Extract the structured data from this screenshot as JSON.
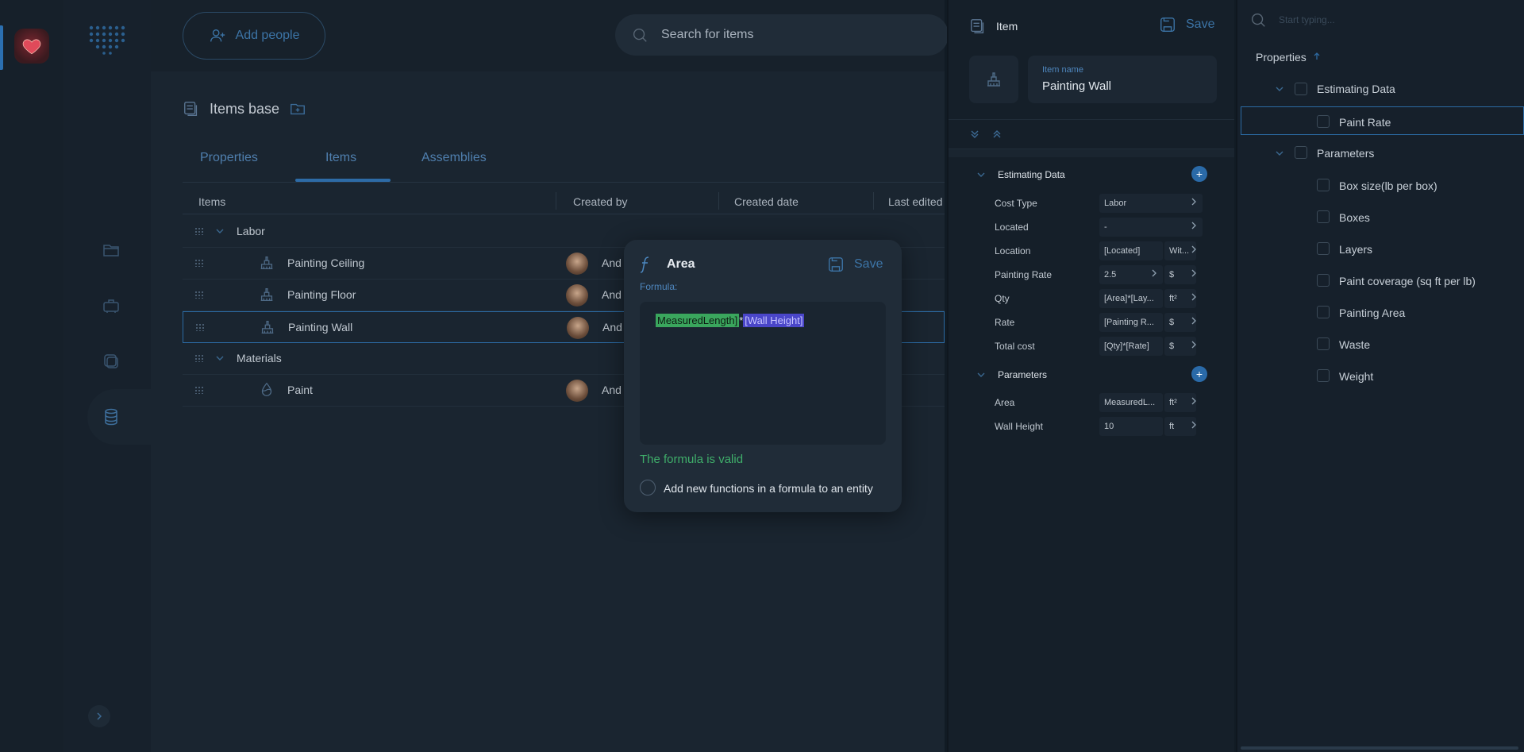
{
  "header": {
    "add_people": "Add people",
    "search_placeholder": "Search for items"
  },
  "page": {
    "title": "Items base"
  },
  "tabs": [
    {
      "label": "Properties"
    },
    {
      "label": "Items"
    },
    {
      "label": "Assemblies"
    }
  ],
  "table": {
    "columns": [
      "Items",
      "Created by",
      "Created date",
      "Last edited"
    ],
    "groups": [
      {
        "label": "Labor",
        "items": [
          {
            "name": "Painting Ceiling",
            "created_by": "And"
          },
          {
            "name": "Painting Floor",
            "created_by": "And"
          },
          {
            "name": "Painting Wall",
            "created_by": "And"
          }
        ]
      },
      {
        "label": "Materials",
        "items": [
          {
            "name": "Paint",
            "created_by": "And"
          }
        ]
      }
    ]
  },
  "formula_popup": {
    "title": "Area",
    "save": "Save",
    "formula_label": "Formula:",
    "token_1": "MeasuredLength]",
    "operator": "*",
    "token_2": "[Wall Height]",
    "status": "The formula is valid",
    "option_label": "Add new functions in a formula to an entity"
  },
  "item_panel": {
    "header": "Item",
    "save": "Save",
    "name_label": "Item name",
    "name_value": "Painting Wall",
    "sections": [
      {
        "title": "Estimating Data",
        "rows": [
          {
            "label": "Cost Type",
            "value": "Labor",
            "unit": ""
          },
          {
            "label": "Located",
            "value": "-",
            "unit": ""
          },
          {
            "label": "Location",
            "value": "[Located]",
            "unit": "Wit..."
          },
          {
            "label": "Painting Rate",
            "value": "2.5",
            "unit": "$"
          },
          {
            "label": "Qty",
            "value": "[Area]*[Lay...",
            "unit": "ft²"
          },
          {
            "label": "Rate",
            "value": "[Painting R...",
            "unit": "$"
          },
          {
            "label": "Total cost",
            "value": "[Qty]*[Rate]",
            "unit": "$"
          }
        ]
      },
      {
        "title": "Parameters",
        "rows": [
          {
            "label": "Area",
            "value": "MeasuredL...",
            "unit": "ft²"
          },
          {
            "label": "Wall Height",
            "value": "10",
            "unit": "ft"
          }
        ]
      }
    ]
  },
  "props_panel": {
    "search_placeholder": "Start typing...",
    "heading": "Properties",
    "groups": [
      {
        "label": "Estimating Data",
        "items": [
          "Paint Rate"
        ]
      },
      {
        "label": "Parameters",
        "items": [
          "Box size(lb per box)",
          "Boxes",
          "Layers",
          "Paint coverage (sq ft per lb)",
          "Painting Area",
          "Waste",
          "Weight"
        ]
      }
    ]
  },
  "colors": {
    "accent": "#2d6ba6",
    "valid": "#3fae6a",
    "token_green": "#3aa65d",
    "token_purple": "#4a46c9"
  }
}
